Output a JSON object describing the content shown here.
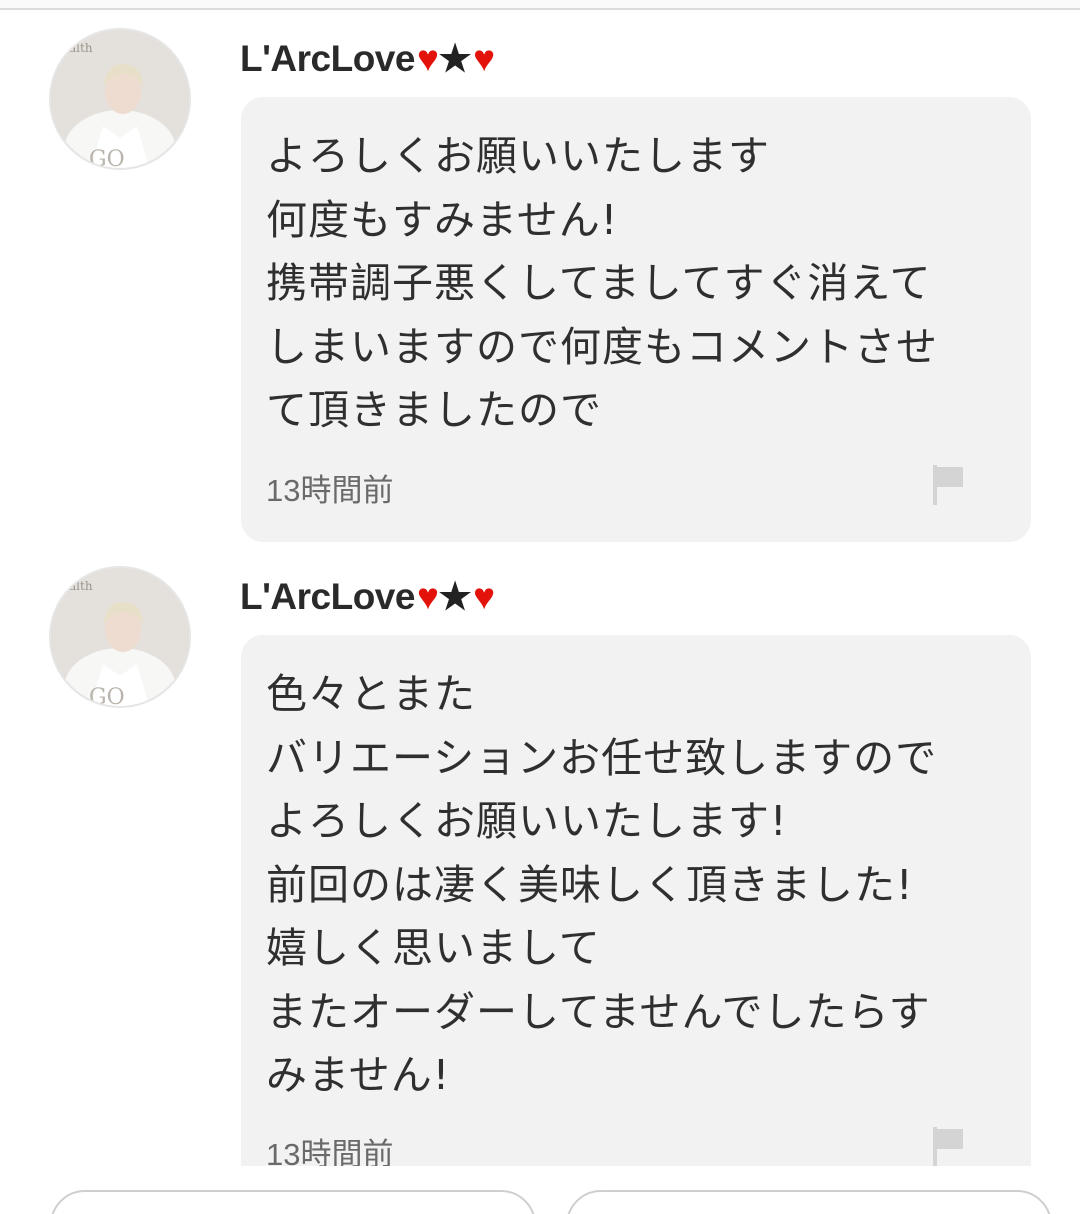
{
  "comments": [
    {
      "username": "L'ArcLove",
      "user_deco": [
        "♥",
        "★",
        "♥"
      ],
      "avatar_icon": "profile-photo",
      "lines": [
        "よろしくお願いいたします",
        "何度もすみません!",
        "携帯調子悪くしてましてすぐ消えて",
        "しまいますので何度もコメントさせ",
        "て頂きましたので"
      ],
      "time": "13時間前",
      "report_icon": "flag-icon"
    },
    {
      "username": "L'ArcLove",
      "user_deco": [
        "♥",
        "★",
        "♥"
      ],
      "avatar_icon": "profile-photo",
      "lines": [
        "色々とまた",
        "バリエーションお任せ致しますので",
        "よろしくお願いいたします!",
        "前回のは凄く美味しく頂きました!",
        "嬉しく思いまして",
        "またオーダーしてませんでしたらす",
        "みません!"
      ],
      "time": "13時間前",
      "report_icon": "flag-icon"
    }
  ],
  "colors": {
    "bubble": "#f2f2f2",
    "heart": "#e3120b",
    "text": "#2f2f2f",
    "meta": "#6a6a6a"
  }
}
